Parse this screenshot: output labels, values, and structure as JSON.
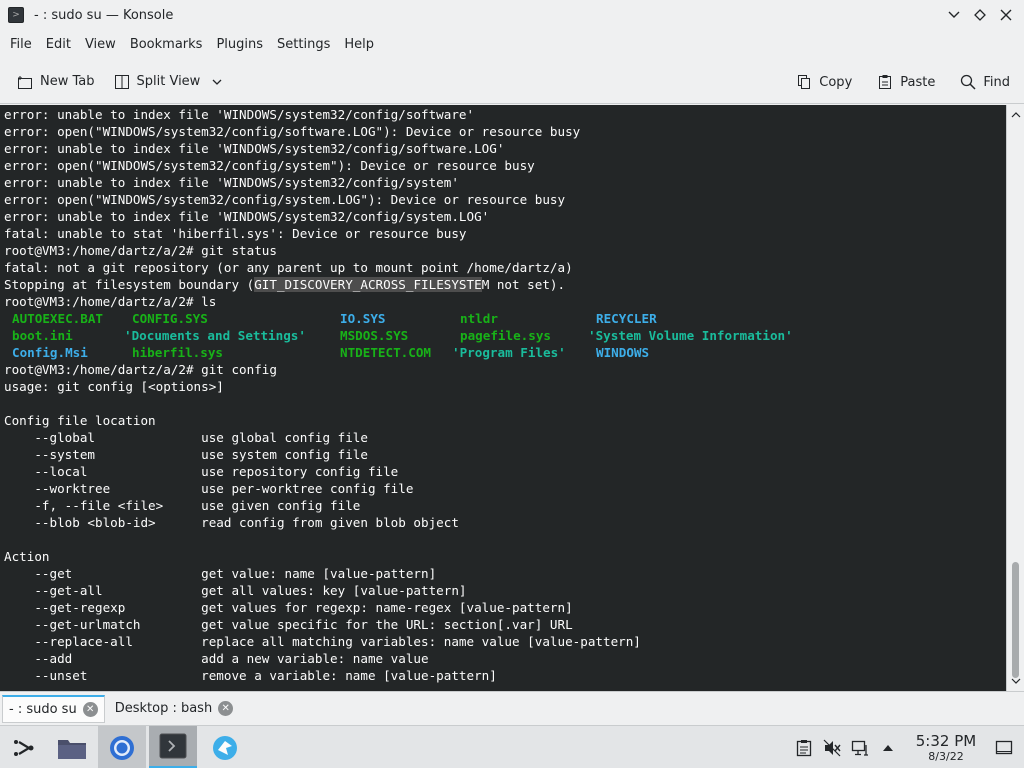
{
  "window": {
    "title": "- : sudo su — Konsole"
  },
  "menu": [
    "File",
    "Edit",
    "View",
    "Bookmarks",
    "Plugins",
    "Settings",
    "Help"
  ],
  "toolbar": {
    "new_tab": "New Tab",
    "split_view": "Split View",
    "copy": "Copy",
    "paste": "Paste",
    "find": "Find"
  },
  "terminal": {
    "lines_before": [
      "error: unable to index file 'WINDOWS/system32/config/software'",
      "error: open(\"WINDOWS/system32/config/software.LOG\"): Device or resource busy",
      "error: unable to index file 'WINDOWS/system32/config/software.LOG'",
      "error: open(\"WINDOWS/system32/config/system\"): Device or resource busy",
      "error: unable to index file 'WINDOWS/system32/config/system'",
      "error: open(\"WINDOWS/system32/config/system.LOG\"): Device or resource busy",
      "error: unable to index file 'WINDOWS/system32/config/system.LOG'",
      "fatal: unable to stat 'hiberfil.sys': Device or resource busy",
      "root@VM3:/home/dartz/a/2# git status",
      "fatal: not a git repository (or any parent up to mount point /home/dartz/a)"
    ],
    "boundary_prefix": "Stopping at filesystem boundary (",
    "boundary_highlight": "GIT_DISCOVERY_ACROSS_FILESYSTE",
    "boundary_suffix": "M not set).",
    "ls_prompt": "root@VM3:/home/dartz/a/2# ls",
    "ls": [
      [
        "AUTOEXEC.BAT",
        "CONFIG.SYS",
        "IO.SYS",
        "ntldr",
        "RECYCLER"
      ],
      [
        "boot.ini",
        "'Documents and Settings'",
        "MSDOS.SYS",
        "pagefile.sys",
        "'System Volume Information'"
      ],
      [
        "Config.Msi",
        "hiberfil.sys",
        "NTDETECT.COM",
        "'Program Files'",
        "WINDOWS"
      ]
    ],
    "lines_after": [
      "root@VM3:/home/dartz/a/2# git config",
      "usage: git config [<options>]",
      "",
      "Config file location",
      "    --global              use global config file",
      "    --system              use system config file",
      "    --local               use repository config file",
      "    --worktree            use per-worktree config file",
      "    -f, --file <file>     use given config file",
      "    --blob <blob-id>      read config from given blob object",
      "",
      "Action",
      "    --get                 get value: name [value-pattern]",
      "    --get-all             get all values: key [value-pattern]",
      "    --get-regexp          get values for regexp: name-regex [value-pattern]",
      "    --get-urlmatch        get value specific for the URL: section[.var] URL",
      "    --replace-all         replace all matching variables: name value [value-pattern]",
      "    --add                 add a new variable: name value",
      "    --unset               remove a variable: name [value-pattern]"
    ]
  },
  "tabs": [
    {
      "label": "- : sudo su",
      "active": true
    },
    {
      "label": "Desktop : bash",
      "active": false
    }
  ],
  "taskbar": {
    "clock_time": "5:32 PM",
    "clock_date": "8/3/22"
  },
  "colors": {
    "terminal_bg": "#232627",
    "terminal_fg": "#fcfcfc",
    "accent": "#3daee9"
  }
}
